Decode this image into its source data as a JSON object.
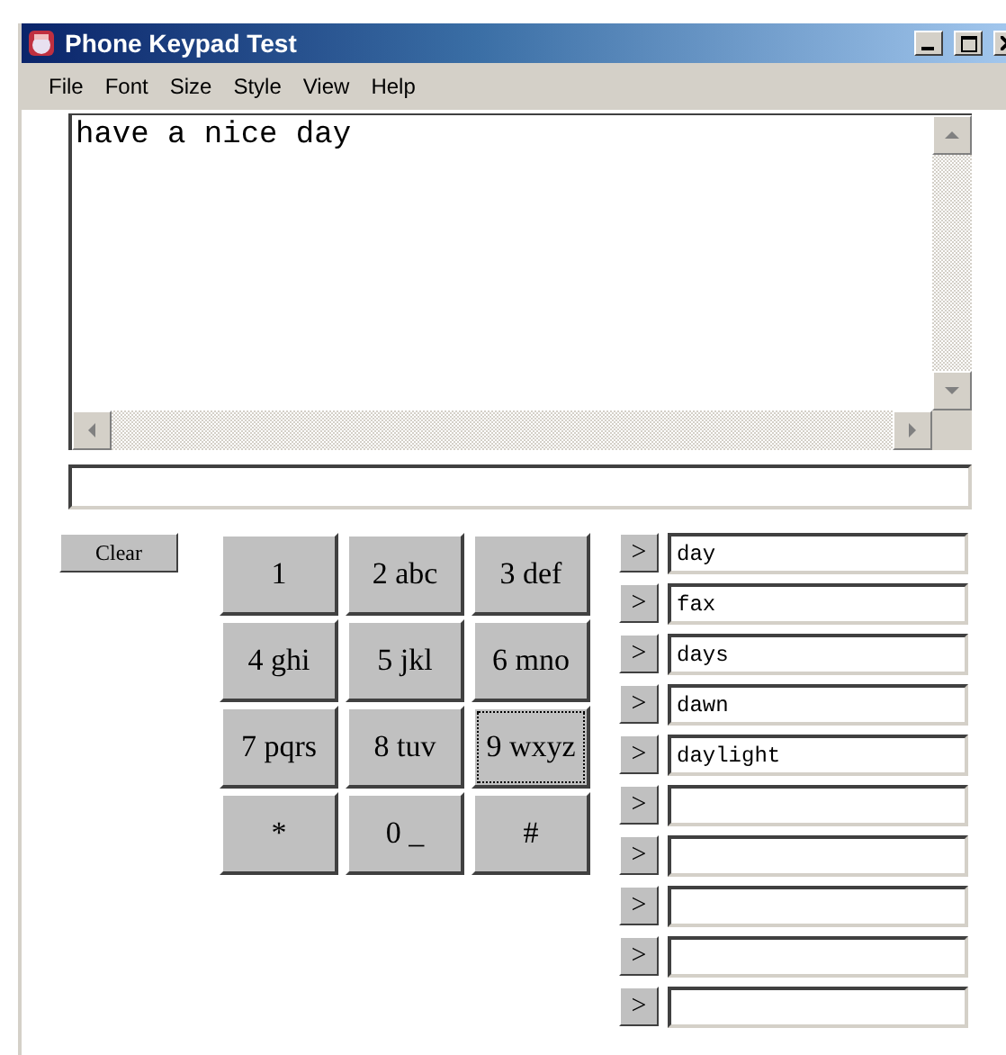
{
  "window": {
    "title": "Phone Keypad Test"
  },
  "menu": [
    "File",
    "Font",
    "Size",
    "Style",
    "View",
    "Help"
  ],
  "text_area": {
    "value": "have a nice day"
  },
  "clear_button": "Clear",
  "keys": [
    {
      "label": "1",
      "focused": false
    },
    {
      "label": "2 abc",
      "focused": false
    },
    {
      "label": "3 def",
      "focused": false
    },
    {
      "label": "4 ghi",
      "focused": false
    },
    {
      "label": "5 jkl",
      "focused": false
    },
    {
      "label": "6 mno",
      "focused": false
    },
    {
      "label": "7 pqrs",
      "focused": false
    },
    {
      "label": "8 tuv",
      "focused": false
    },
    {
      "label": "9 wxyz",
      "focused": true
    },
    {
      "label": "*",
      "focused": false
    },
    {
      "label": "0 _",
      "focused": false
    },
    {
      "label": "#",
      "focused": false
    }
  ],
  "suggestions": [
    {
      "button": ">",
      "value": "day"
    },
    {
      "button": ">",
      "value": "fax"
    },
    {
      "button": ">",
      "value": "days"
    },
    {
      "button": ">",
      "value": "dawn"
    },
    {
      "button": ">",
      "value": "daylight"
    },
    {
      "button": ">"
    },
    {
      "button": ">"
    },
    {
      "button": ">"
    },
    {
      "button": ">"
    },
    {
      "button": ">"
    }
  ]
}
